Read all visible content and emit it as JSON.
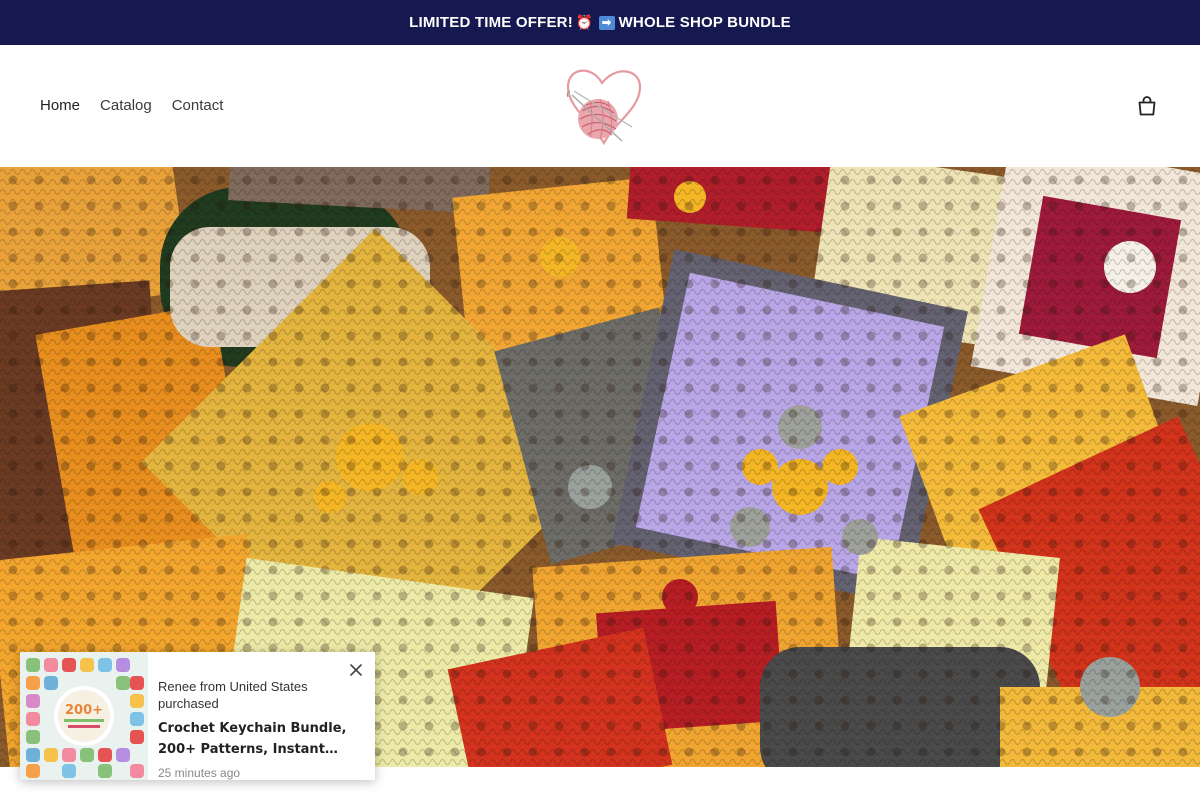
{
  "announcement": {
    "text_start": "LIMITED TIME OFFER!",
    "clock_emoji": "⏰",
    "arrow_emoji": "➡",
    "text_end": "WHOLE SHOP BUNDLE",
    "background": "#15194f"
  },
  "header": {
    "nav": [
      {
        "label": "Home"
      },
      {
        "label": "Catalog"
      },
      {
        "label": "Contact"
      }
    ],
    "logo_icon": "heart-yarn-ball-logo",
    "cart_icon": "shopping-bag-icon"
  },
  "hero": {
    "image_icon": "crochet-granny-squares-image"
  },
  "popup": {
    "who": "Renee from United States purchased",
    "product": "Crochet Keychain Bundle, 200+ Patterns, Instant…",
    "time": "25 minutes ago",
    "thumb_badge": "200+",
    "close_icon": "close-icon"
  }
}
